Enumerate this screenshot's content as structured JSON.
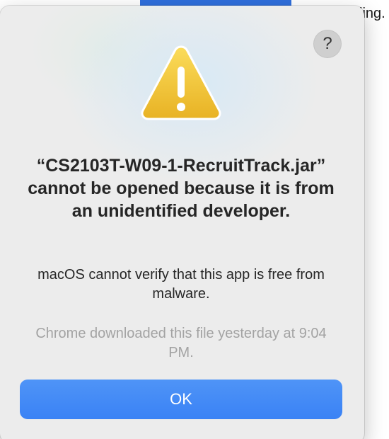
{
  "background": {
    "partial_text": "ling."
  },
  "dialog": {
    "help_label": "?",
    "title": "“CS2103T-W09-1-RecruitTrack.jar” cannot be opened because it is from an unidentified developer.",
    "message": "macOS cannot verify that this app is free from malware.",
    "footnote": "Chrome downloaded this file yesterday at 9:04 PM.",
    "ok_label": "OK"
  },
  "colors": {
    "accent": "#3a82f5",
    "warning": "#f2c12e"
  },
  "icons": {
    "help": "question-mark-icon",
    "alert": "warning-triangle-icon"
  }
}
